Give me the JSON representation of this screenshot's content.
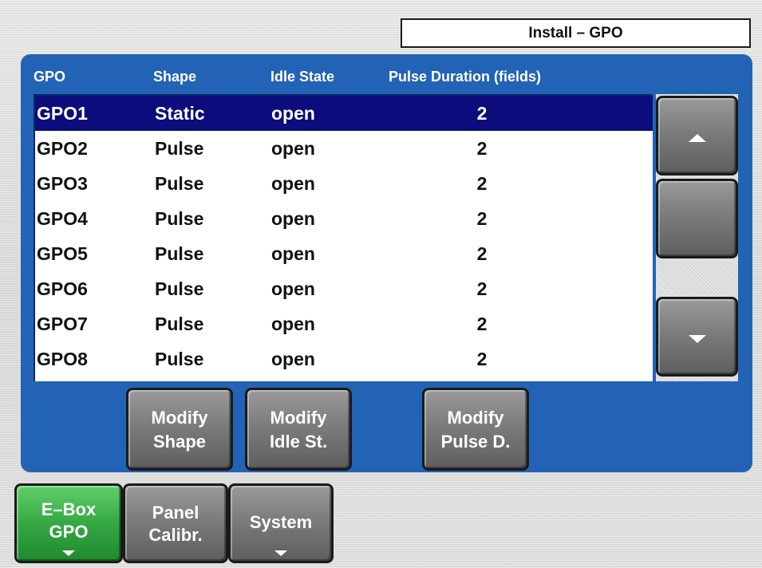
{
  "window": {
    "title": "Install – GPO"
  },
  "columns": {
    "gpo": "GPO",
    "shape": "Shape",
    "idle": "Idle State",
    "pulse": "Pulse Duration (fields)"
  },
  "rows": [
    {
      "gpo": "GPO1",
      "shape": "Static",
      "idle": "open",
      "pulse": "2",
      "selected": true
    },
    {
      "gpo": "GPO2",
      "shape": "Pulse",
      "idle": "open",
      "pulse": "2"
    },
    {
      "gpo": "GPO3",
      "shape": "Pulse",
      "idle": "open",
      "pulse": "2"
    },
    {
      "gpo": "GPO4",
      "shape": "Pulse",
      "idle": "open",
      "pulse": "2"
    },
    {
      "gpo": "GPO5",
      "shape": "Pulse",
      "idle": "open",
      "pulse": "2"
    },
    {
      "gpo": "GPO6",
      "shape": "Pulse",
      "idle": "open",
      "pulse": "2"
    },
    {
      "gpo": "GPO7",
      "shape": "Pulse",
      "idle": "open",
      "pulse": "2"
    },
    {
      "gpo": "GPO8",
      "shape": "Pulse",
      "idle": "open",
      "pulse": "2"
    }
  ],
  "buttons": {
    "modify_shape": [
      "Modify",
      "Shape"
    ],
    "modify_idle": [
      "Modify",
      "Idle St."
    ],
    "modify_pulse": [
      "Modify",
      "Pulse D."
    ]
  },
  "tabs": {
    "ebox": [
      "E–Box",
      "GPO"
    ],
    "panel": [
      "Panel",
      "Calibr."
    ],
    "system": "System"
  },
  "icons": {
    "scroll_up": "triangle-up-icon",
    "scroll_down": "triangle-down-icon",
    "tab_menu": "triangle-down-icon"
  },
  "colors": {
    "panel": "#2363b6",
    "selection": "#0c0c7c",
    "active_tab": "#36a843"
  }
}
